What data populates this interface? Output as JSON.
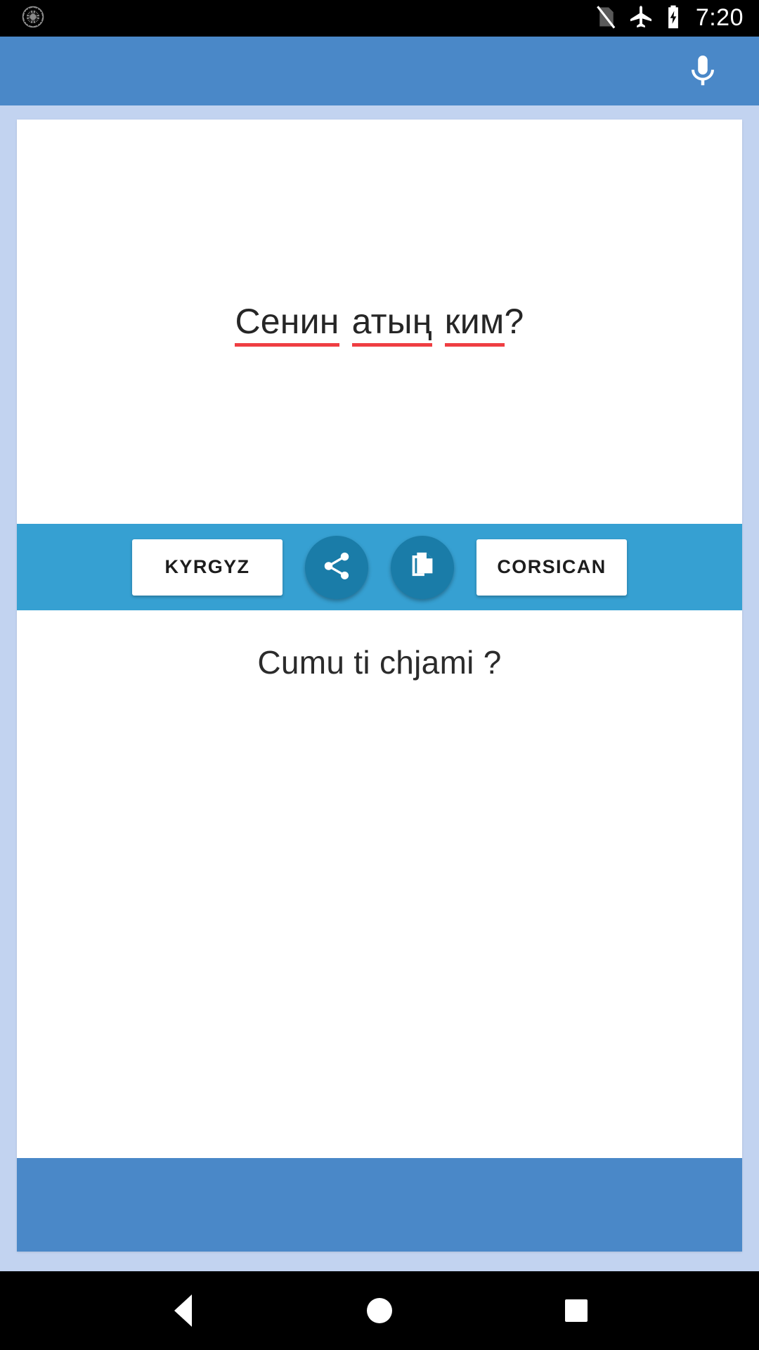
{
  "status_bar": {
    "app_icon": "app-notification-icon",
    "icons": [
      "no-sim-icon",
      "airplane-mode-icon",
      "battery-charging-icon"
    ],
    "clock": "7:20"
  },
  "app_bar": {
    "mic_icon": "microphone-icon",
    "background_color": "#4a88c8"
  },
  "translator": {
    "source_text": "Сенин атың ким?",
    "source_words": [
      {
        "text": "Сенин",
        "misspelled": true
      },
      {
        "text": "атың",
        "misspelled": true
      },
      {
        "text": "ким",
        "misspelled": true
      },
      {
        "text": "?",
        "misspelled": false
      }
    ],
    "target_text": "Cumu ti chjami ?",
    "source_language": "KYRGYZ",
    "target_language": "CORSICAN",
    "share_icon": "share-icon",
    "copy_icon": "copy-icon",
    "toolbar_color": "#36a0d2",
    "fab_color": "#1a7ca8",
    "spellcheck_underline_color": "#ef3e42",
    "page_background_color": "#c2d3f0"
  },
  "ad_banner": {
    "label": "",
    "background_color": "#4a88c8"
  },
  "nav_bar": {
    "back_label": "back-button",
    "home_label": "home-button",
    "recents_label": "recents-button"
  }
}
